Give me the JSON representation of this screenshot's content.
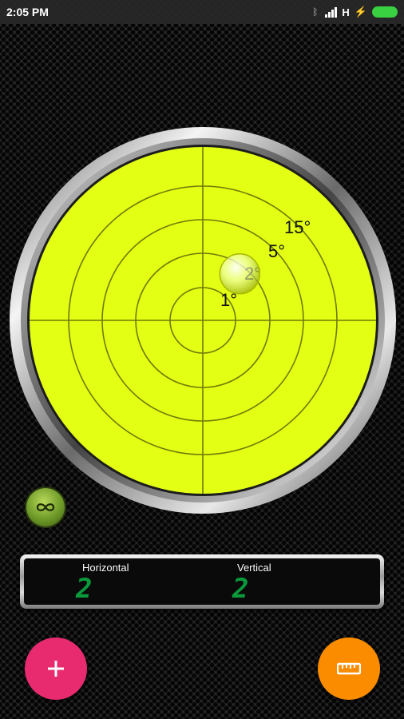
{
  "status_bar": {
    "time": "2:05 PM",
    "network": "H"
  },
  "level": {
    "ring_labels": [
      "1°",
      "2°",
      "5°",
      "15°"
    ],
    "face_color": "#e2ff14",
    "bubble": {
      "x_deg": 2,
      "y_deg": 2
    }
  },
  "readout": {
    "horizontal_label": "Horizontal",
    "vertical_label": "Vertical",
    "horizontal_value": "2",
    "vertical_value": "2",
    "digit_color": "#0a9a3c"
  },
  "icons": {
    "lock_toggle": "infinity-icon",
    "add_button": "plus-icon",
    "ruler_button": "ruler-icon"
  },
  "colors": {
    "add_fab": "#e82b6f",
    "ruler_fab": "#fb8c00"
  }
}
